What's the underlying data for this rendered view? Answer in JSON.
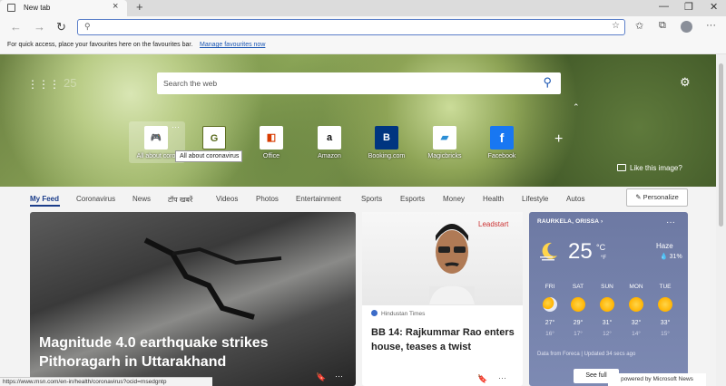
{
  "browser": {
    "tab_title": "New tab",
    "tab_close": "×",
    "new_tab": "+",
    "window_controls": [
      "—",
      "❐",
      "✕"
    ],
    "nav": {
      "back": "←",
      "forward": "→",
      "refresh": "↻"
    },
    "address_placeholder": "",
    "toolbar_icons": [
      "favorites-icon",
      "collections-icon",
      "profile-icon",
      "more-icon"
    ],
    "more": "···"
  },
  "favourites_bar": {
    "hint": "For quick access, place your favourites here on the favourites bar.",
    "manage_link": "Manage favourites now"
  },
  "hero": {
    "temperature_faint": "25",
    "search_placeholder": "Search the web",
    "like_text": "Like this image?",
    "tooltip": "All about coronavirus",
    "tile_more": "···",
    "tiles": [
      {
        "label": "All about coro",
        "glyph": "🎮",
        "color": "#1e8f3a"
      },
      {
        "label": "",
        "glyph": "G",
        "color": "#5b6c1f"
      },
      {
        "label": "Office",
        "glyph": "◧",
        "color": "#d83b01"
      },
      {
        "label": "Amazon",
        "glyph": "a",
        "color": "#111111"
      },
      {
        "label": "Booking.com",
        "glyph": "B",
        "color": "#003580"
      },
      {
        "label": "Magicbricks",
        "glyph": "▰",
        "color": "#2c8fd6"
      },
      {
        "label": "Facebook",
        "glyph": "f",
        "color": "#1877f2"
      }
    ]
  },
  "categories": {
    "items": [
      "My Feed",
      "Coronavirus",
      "News",
      "टॉप खबरें",
      "Videos",
      "Photos",
      "Entertainment",
      "Sports",
      "Esports",
      "Money",
      "Health",
      "Lifestyle",
      "Autos"
    ],
    "personalize": "✎ Personalize"
  },
  "cards": {
    "main": {
      "title": "Magnitude 4.0 earthquake strikes Pithoragarh in Uttarakhand"
    },
    "second": {
      "source": "Hindustan Times",
      "title": "BB 14: Rajkummar Rao enters house, teases a twist",
      "photo_text": "Leadstart"
    },
    "actions": {
      "save": "🔖",
      "more": "···"
    }
  },
  "weather": {
    "location": "RAURKELA, ORISSA",
    "more": "···",
    "temp": "25",
    "unit_c": "°C",
    "unit_f": "°F",
    "condition": "Haze",
    "rain": "💧 31%",
    "days": [
      {
        "name": "FRI",
        "hi": "27°",
        "lo": "16°",
        "icon": "partly-cloudy-icon"
      },
      {
        "name": "SAT",
        "hi": "29°",
        "lo": "17°",
        "icon": "sun-icon"
      },
      {
        "name": "SUN",
        "hi": "31°",
        "lo": "12°",
        "icon": "sun-icon"
      },
      {
        "name": "MON",
        "hi": "32°",
        "lo": "14°",
        "icon": "sun-icon"
      },
      {
        "name": "TUE",
        "hi": "33°",
        "lo": "15°",
        "icon": "sun-icon"
      }
    ],
    "data_note": "Data from Foreca | Updated 34 secs ago",
    "see_full": "See full"
  },
  "powered_by": "powered by Microsoft News",
  "status_url": "https://www.msn.com/en-in/health/coronavirus?ocid=msedgntp",
  "colors": {
    "accent": "#1b3d8a",
    "link": "#1a56b3",
    "weather_bg": "#7480ab"
  }
}
